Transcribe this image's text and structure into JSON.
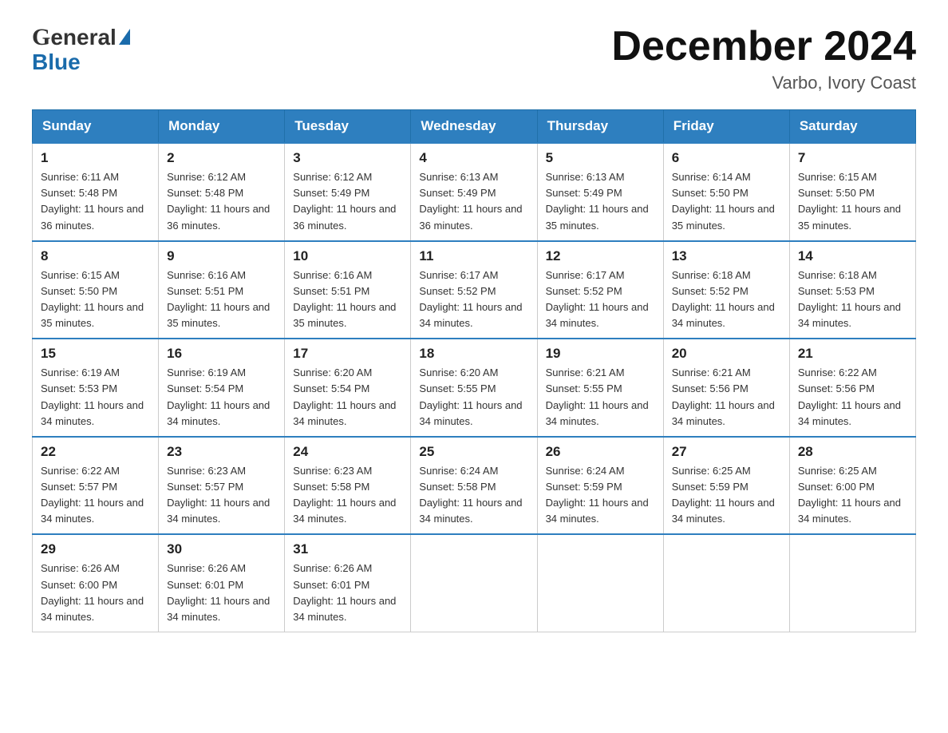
{
  "header": {
    "logo_general": "General",
    "logo_blue": "Blue",
    "month_title": "December 2024",
    "location": "Varbo, Ivory Coast"
  },
  "weekdays": [
    "Sunday",
    "Monday",
    "Tuesday",
    "Wednesday",
    "Thursday",
    "Friday",
    "Saturday"
  ],
  "weeks": [
    [
      {
        "day": "1",
        "sunrise": "6:11 AM",
        "sunset": "5:48 PM",
        "daylight": "11 hours and 36 minutes."
      },
      {
        "day": "2",
        "sunrise": "6:12 AM",
        "sunset": "5:48 PM",
        "daylight": "11 hours and 36 minutes."
      },
      {
        "day": "3",
        "sunrise": "6:12 AM",
        "sunset": "5:49 PM",
        "daylight": "11 hours and 36 minutes."
      },
      {
        "day": "4",
        "sunrise": "6:13 AM",
        "sunset": "5:49 PM",
        "daylight": "11 hours and 36 minutes."
      },
      {
        "day": "5",
        "sunrise": "6:13 AM",
        "sunset": "5:49 PM",
        "daylight": "11 hours and 35 minutes."
      },
      {
        "day": "6",
        "sunrise": "6:14 AM",
        "sunset": "5:50 PM",
        "daylight": "11 hours and 35 minutes."
      },
      {
        "day": "7",
        "sunrise": "6:15 AM",
        "sunset": "5:50 PM",
        "daylight": "11 hours and 35 minutes."
      }
    ],
    [
      {
        "day": "8",
        "sunrise": "6:15 AM",
        "sunset": "5:50 PM",
        "daylight": "11 hours and 35 minutes."
      },
      {
        "day": "9",
        "sunrise": "6:16 AM",
        "sunset": "5:51 PM",
        "daylight": "11 hours and 35 minutes."
      },
      {
        "day": "10",
        "sunrise": "6:16 AM",
        "sunset": "5:51 PM",
        "daylight": "11 hours and 35 minutes."
      },
      {
        "day": "11",
        "sunrise": "6:17 AM",
        "sunset": "5:52 PM",
        "daylight": "11 hours and 34 minutes."
      },
      {
        "day": "12",
        "sunrise": "6:17 AM",
        "sunset": "5:52 PM",
        "daylight": "11 hours and 34 minutes."
      },
      {
        "day": "13",
        "sunrise": "6:18 AM",
        "sunset": "5:52 PM",
        "daylight": "11 hours and 34 minutes."
      },
      {
        "day": "14",
        "sunrise": "6:18 AM",
        "sunset": "5:53 PM",
        "daylight": "11 hours and 34 minutes."
      }
    ],
    [
      {
        "day": "15",
        "sunrise": "6:19 AM",
        "sunset": "5:53 PM",
        "daylight": "11 hours and 34 minutes."
      },
      {
        "day": "16",
        "sunrise": "6:19 AM",
        "sunset": "5:54 PM",
        "daylight": "11 hours and 34 minutes."
      },
      {
        "day": "17",
        "sunrise": "6:20 AM",
        "sunset": "5:54 PM",
        "daylight": "11 hours and 34 minutes."
      },
      {
        "day": "18",
        "sunrise": "6:20 AM",
        "sunset": "5:55 PM",
        "daylight": "11 hours and 34 minutes."
      },
      {
        "day": "19",
        "sunrise": "6:21 AM",
        "sunset": "5:55 PM",
        "daylight": "11 hours and 34 minutes."
      },
      {
        "day": "20",
        "sunrise": "6:21 AM",
        "sunset": "5:56 PM",
        "daylight": "11 hours and 34 minutes."
      },
      {
        "day": "21",
        "sunrise": "6:22 AM",
        "sunset": "5:56 PM",
        "daylight": "11 hours and 34 minutes."
      }
    ],
    [
      {
        "day": "22",
        "sunrise": "6:22 AM",
        "sunset": "5:57 PM",
        "daylight": "11 hours and 34 minutes."
      },
      {
        "day": "23",
        "sunrise": "6:23 AM",
        "sunset": "5:57 PM",
        "daylight": "11 hours and 34 minutes."
      },
      {
        "day": "24",
        "sunrise": "6:23 AM",
        "sunset": "5:58 PM",
        "daylight": "11 hours and 34 minutes."
      },
      {
        "day": "25",
        "sunrise": "6:24 AM",
        "sunset": "5:58 PM",
        "daylight": "11 hours and 34 minutes."
      },
      {
        "day": "26",
        "sunrise": "6:24 AM",
        "sunset": "5:59 PM",
        "daylight": "11 hours and 34 minutes."
      },
      {
        "day": "27",
        "sunrise": "6:25 AM",
        "sunset": "5:59 PM",
        "daylight": "11 hours and 34 minutes."
      },
      {
        "day": "28",
        "sunrise": "6:25 AM",
        "sunset": "6:00 PM",
        "daylight": "11 hours and 34 minutes."
      }
    ],
    [
      {
        "day": "29",
        "sunrise": "6:26 AM",
        "sunset": "6:00 PM",
        "daylight": "11 hours and 34 minutes."
      },
      {
        "day": "30",
        "sunrise": "6:26 AM",
        "sunset": "6:01 PM",
        "daylight": "11 hours and 34 minutes."
      },
      {
        "day": "31",
        "sunrise": "6:26 AM",
        "sunset": "6:01 PM",
        "daylight": "11 hours and 34 minutes."
      },
      null,
      null,
      null,
      null
    ]
  ]
}
